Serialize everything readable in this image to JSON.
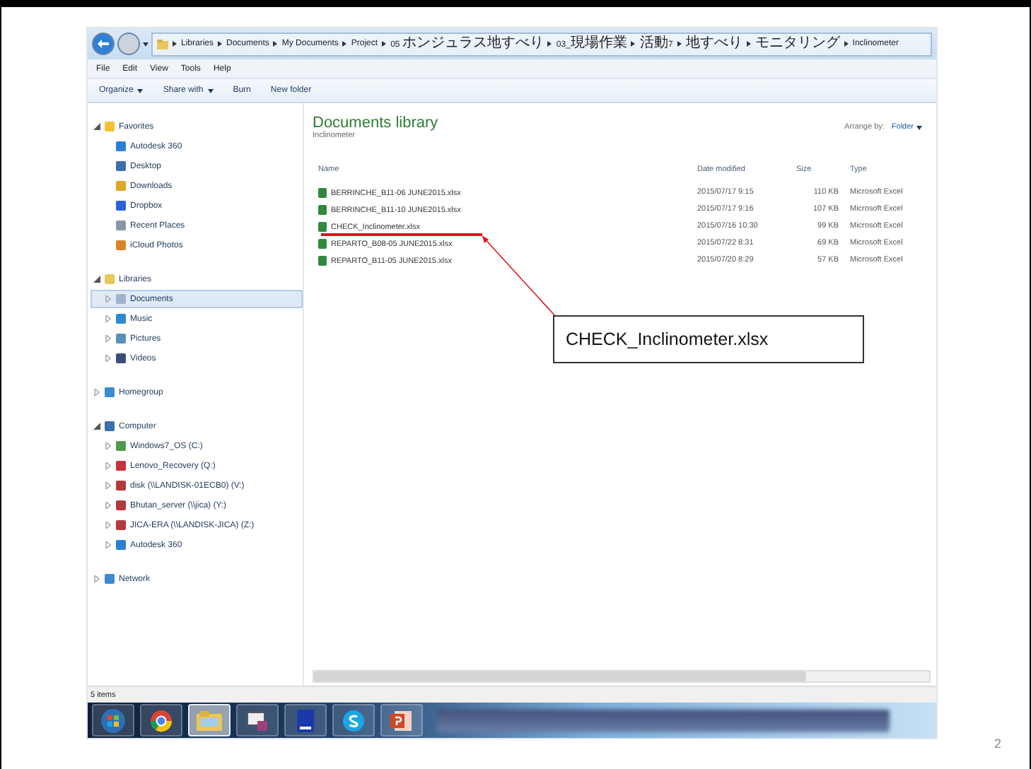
{
  "address_bar": {
    "crumbs": [
      "Libraries",
      "Documents",
      "My Documents",
      "Project",
      "05 ホンジュラス地すべり",
      "03_現場作業",
      "活動7",
      "地すべり",
      "モニタリング",
      "Inclinometer"
    ]
  },
  "menu_bar": [
    "File",
    "Edit",
    "View",
    "Tools",
    "Help"
  ],
  "toolbar": [
    {
      "label": "Organize",
      "dropdown": true
    },
    {
      "label": "Share with",
      "dropdown": true
    },
    {
      "label": "Burn",
      "dropdown": false
    },
    {
      "label": "New folder",
      "dropdown": false
    }
  ],
  "navigation": [
    {
      "label": "Favorites",
      "expanded": true,
      "selected": false,
      "children": [
        {
          "label": "Autodesk 360",
          "selected": false
        },
        {
          "label": "Desktop",
          "selected": false
        },
        {
          "label": "Downloads",
          "selected": false
        },
        {
          "label": "Dropbox",
          "selected": false
        },
        {
          "label": "Recent Places",
          "selected": false
        },
        {
          "label": "iCloud Photos",
          "selected": false
        }
      ]
    },
    {
      "label": "Libraries",
      "expanded": true,
      "selected": false,
      "children": [
        {
          "label": "Documents",
          "expanded": false,
          "selected": true
        },
        {
          "label": "Music",
          "expanded": false,
          "selected": false
        },
        {
          "label": "Pictures",
          "expanded": false,
          "selected": false
        },
        {
          "label": "Videos",
          "expanded": false,
          "selected": false
        }
      ]
    },
    {
      "label": "Homegroup",
      "expanded": false,
      "selected": false
    },
    {
      "label": "Computer",
      "expanded": true,
      "selected": false,
      "children": [
        {
          "label": "Windows7_OS (C:)",
          "expanded": false,
          "selected": false
        },
        {
          "label": "Lenovo_Recovery (Q:)",
          "expanded": false,
          "selected": false
        },
        {
          "label": "disk (\\\\LANDISK-01ECB0) (V:)",
          "expanded": false,
          "selected": false
        },
        {
          "label": "Bhutan_server (\\\\jica) (Y:)",
          "expanded": false,
          "selected": false
        },
        {
          "label": "JICA-ERA (\\\\LANDISK-JICA) (Z:)",
          "expanded": false,
          "selected": false
        },
        {
          "label": "Autodesk 360",
          "expanded": false,
          "selected": false
        }
      ]
    },
    {
      "label": "Network",
      "expanded": false,
      "selected": false
    }
  ],
  "library": {
    "title": "Documents library",
    "subtitle": "Inclinometer",
    "arrange_label": "Arrange by:",
    "arrange_value": "Folder"
  },
  "table": {
    "columns": [
      "Name",
      "Date modified",
      "Size",
      "Type"
    ],
    "rows": [
      {
        "name": "BERRINCHE_B11-06 JUNE2015.xlsx",
        "date": "2015/07/17 9:15",
        "size": "110 KB",
        "type": "Microsoft Excel"
      },
      {
        "name": "BERRINCHE_B11-10 JUNE2015.xlsx",
        "date": "2015/07/17 9:16",
        "size": "107 KB",
        "type": "Microsoft Excel"
      },
      {
        "name": "CHECK_Inclinometer.xlsx",
        "date": "2015/07/16 10:30",
        "size": "99 KB",
        "type": "Microsoft Excel"
      },
      {
        "name": "REPARTO_B08-05 JUNE2015.xlsx",
        "date": "2015/07/22 8:31",
        "size": "69 KB",
        "type": "Microsoft Excel"
      },
      {
        "name": "REPARTO_B11-05 JUNE2015.xlsx",
        "date": "2015/07/20 8:29",
        "size": "57 KB",
        "type": "Microsoft Excel"
      }
    ]
  },
  "status_bar": "5 items",
  "taskbar": [
    {
      "kind": "start",
      "selected": false
    },
    {
      "kind": "browser",
      "selected": false
    },
    {
      "kind": "folder",
      "selected": true
    },
    {
      "kind": "mail",
      "selected": false
    },
    {
      "kind": "book",
      "selected": false
    },
    {
      "kind": "chat",
      "selected": false
    },
    {
      "kind": "slides",
      "selected": false
    }
  ],
  "callout": {
    "text": "CHECK_Inclinometer.xlsx"
  },
  "page_number": "2"
}
